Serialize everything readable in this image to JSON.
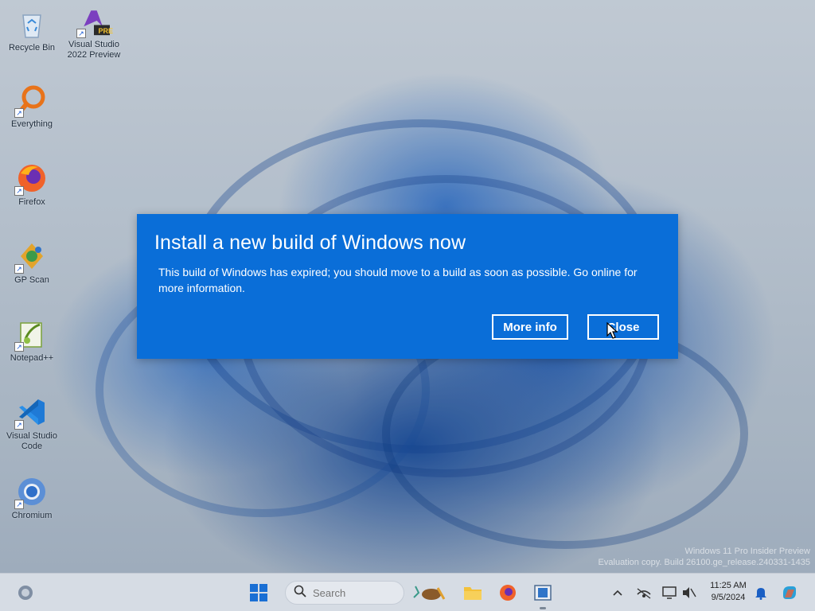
{
  "desktop": {
    "icons": [
      {
        "label": "Recycle Bin",
        "icon": "recycle-bin-icon"
      },
      {
        "label": "Visual Studio 2022 Preview",
        "icon": "visual-studio-preview-icon",
        "badge": "PRE"
      },
      {
        "label": "Everything",
        "icon": "everything-search-icon"
      },
      {
        "label": "Firefox",
        "icon": "firefox-icon"
      },
      {
        "label": "GP Scan",
        "icon": "gp-scan-icon"
      },
      {
        "label": "Notepad++",
        "icon": "notepad-plus-plus-icon"
      },
      {
        "label": "Visual Studio Code",
        "icon": "vscode-icon"
      },
      {
        "label": "Chromium",
        "icon": "chromium-icon"
      }
    ],
    "watermark": {
      "line1": "Windows 11 Pro Insider Preview",
      "line2": "Evaluation copy. Build 26100.ge_release.240331-1435"
    }
  },
  "dialog": {
    "title": "Install a new build of Windows now",
    "message": "This build of Windows has expired; you should move to a build as soon as possible. Go online for more information.",
    "more_info_label": "More info",
    "close_label": "Close",
    "background_color": "#0a6ed8"
  },
  "taskbar": {
    "search_placeholder": "Search",
    "clock_time": "11:25 AM",
    "clock_date": "9/5/2024",
    "pinned": [
      "start-icon",
      "search-icon",
      "widgets-icon",
      "file-explorer-icon",
      "firefox-icon",
      "task-view-icon"
    ],
    "tray": [
      "chevron-up-icon",
      "network-icon",
      "display-icon",
      "volume-icon",
      "notification-bell-icon",
      "copilot-icon"
    ]
  }
}
